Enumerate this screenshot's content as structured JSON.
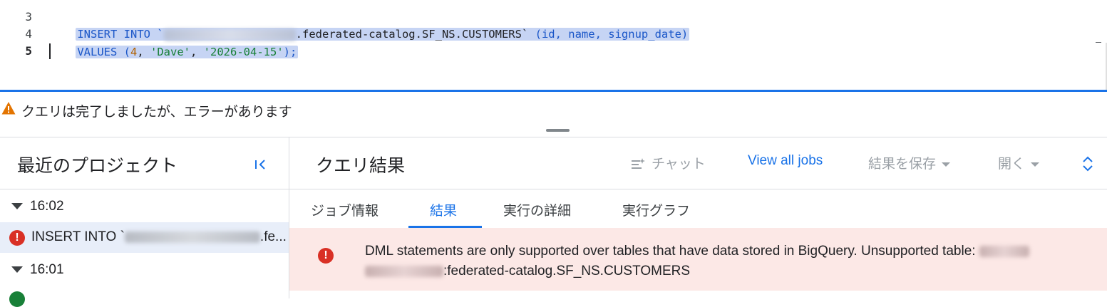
{
  "editor": {
    "line_numbers": [
      "3",
      "4",
      "5"
    ],
    "line3": {
      "kw": "INSERT INTO `",
      "table": ".federated-catalog.SF_NS.CUSTOMERS`",
      "cols": " (id, name, signup_date)"
    },
    "line4": {
      "kw": "VALUES (",
      "num": "4",
      "sep1": ", ",
      "str1": "'Dave'",
      "sep2": ", ",
      "str2": "'2026-04-15'",
      "end": ");"
    }
  },
  "status": {
    "icon": "warning-icon",
    "text": "クエリは完了しましたが、エラーがあります"
  },
  "left_panel": {
    "title": "最近のプロジェクト",
    "groups": [
      {
        "time": "16:02",
        "item": {
          "status": "error",
          "prefix": "INSERT INTO `",
          "suffix": ".fe..."
        }
      },
      {
        "time": "16:01",
        "item": {
          "status": "ok"
        }
      }
    ]
  },
  "right_panel": {
    "title": "クエリ結果",
    "toolbar": {
      "chat": "チャット",
      "view_all_jobs": "View all jobs",
      "save_results": "結果を保存",
      "open": "開く"
    },
    "tabs": [
      "ジョブ情報",
      "結果",
      "実行の詳細",
      "実行グラフ"
    ],
    "active_tab": "結果",
    "error": {
      "line1": "DML statements are only supported over tables that have data stored in BigQuery. Unsupported table: ",
      "line2": ":federated-catalog.SF_NS.CUSTOMERS"
    }
  },
  "colors": {
    "accent": "#1a73e8",
    "error": "#d93025",
    "warning": "#e37400",
    "error_bg": "#fce8e6",
    "selection": "#c6d4f4"
  }
}
